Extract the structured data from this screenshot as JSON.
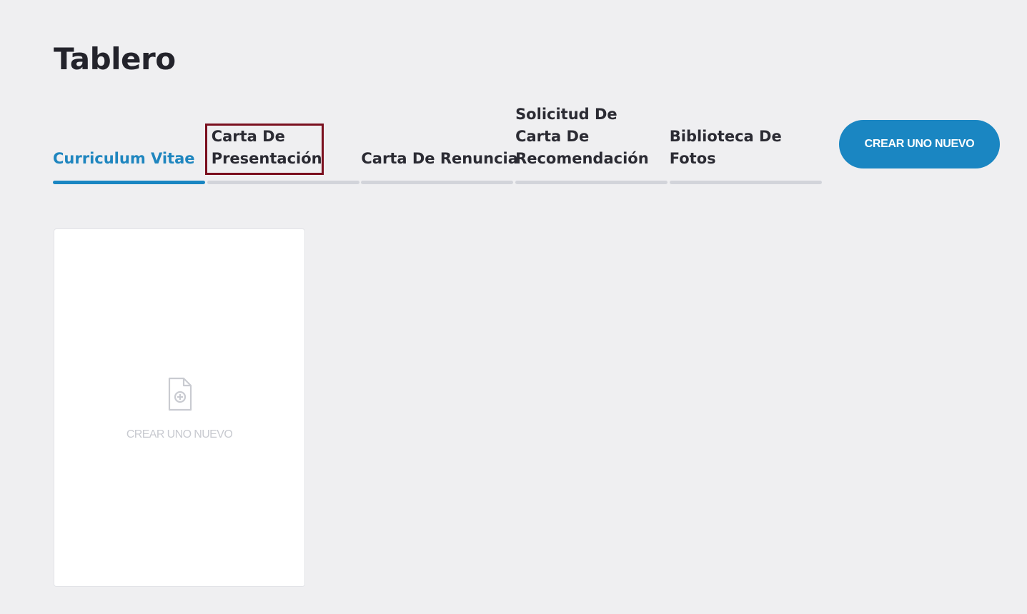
{
  "page": {
    "title": "Tablero"
  },
  "tabs": [
    {
      "label": "Curriculum Vitae",
      "active": true
    },
    {
      "label": "Carta De Presentación",
      "active": false,
      "highlighted": true
    },
    {
      "label": "Carta De Renuncia",
      "active": false
    },
    {
      "label": "Solicitud De Carta De Recomendación",
      "active": false
    },
    {
      "label": "Biblioteca De Fotos",
      "active": false
    }
  ],
  "header": {
    "create_button_label": "CREAR UNO NUEVO"
  },
  "card": {
    "create_label": "CREAR UNO NUEVO",
    "icon": "document-add-icon"
  },
  "colors": {
    "accent": "#1a86c2",
    "background": "#efeff1",
    "highlight_border": "#7a0f1e",
    "inactive_bar": "#d2d4da",
    "muted_text": "#c8cad0"
  }
}
